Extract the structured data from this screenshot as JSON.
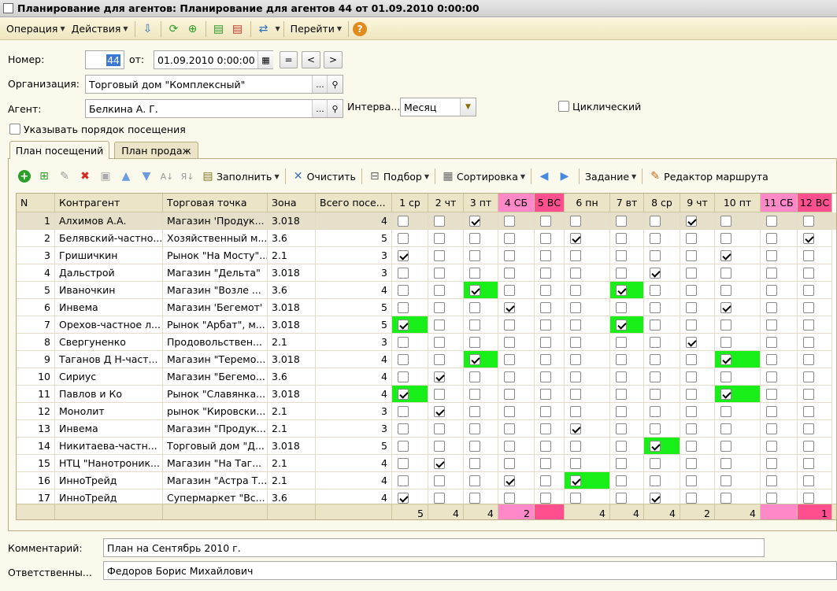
{
  "window": {
    "title": "Планирование для агентов: Планирование для агентов 44 от 01.09.2010 0:00:00"
  },
  "menubar": {
    "operation": "Операция",
    "actions": "Действия",
    "goto": "Перейти"
  },
  "form": {
    "number_label": "Номер:",
    "number": "44",
    "from_label": "от:",
    "date": "01.09.2010  0:00:00",
    "eq_btn": "=",
    "prev_btn": "<",
    "next_btn": ">",
    "org_label": "Организация:",
    "org": "Торговый дом \"Комплексный\"",
    "agent_label": "Агент:",
    "agent": "Белкина А. Г.",
    "interval_label": "Интерва...",
    "interval": "Месяц",
    "cyclic_label": "Циклический",
    "order_label": "Указывать порядок посещения",
    "ellipsis": "...",
    "comment_label": "Комментарий:",
    "comment": "План на Сентябрь 2010 г.",
    "resp_label": "Ответственны...",
    "resp": "Федоров Борис Михайлович"
  },
  "tabs": [
    "План посещений",
    "План продаж"
  ],
  "toolbar": {
    "fill": "Заполнить",
    "clear": "Очистить",
    "selection": "Подбор",
    "sort": "Сортировка",
    "task": "Задание",
    "route_editor": "Редактор маршрута"
  },
  "grid": {
    "headers": [
      "N",
      "Контрагент",
      "Торговая точка",
      "Зона",
      "Всего посе..."
    ],
    "days": [
      {
        "label": "1 ср",
        "kind": "work"
      },
      {
        "label": "2 чт",
        "kind": "work"
      },
      {
        "label": "3 пт",
        "kind": "work"
      },
      {
        "label": "4 СБ",
        "kind": "sat"
      },
      {
        "label": "5 ВС",
        "kind": "sun"
      },
      {
        "label": "6 пн",
        "kind": "work"
      },
      {
        "label": "7 вт",
        "kind": "work"
      },
      {
        "label": "8 ср",
        "kind": "work"
      },
      {
        "label": "9 чт",
        "kind": "work"
      },
      {
        "label": "10 пт",
        "kind": "work"
      },
      {
        "label": "11 СБ",
        "kind": "sat"
      },
      {
        "label": "12 ВС",
        "kind": "sun"
      }
    ],
    "rows": [
      {
        "n": "1",
        "contractor": "Алхимов А.А.",
        "point": "Магазин 'Продук...",
        "zone": "3.018",
        "total": "4",
        "checks": [
          0,
          0,
          1,
          0,
          0,
          0,
          0,
          0,
          1,
          0,
          0,
          0
        ],
        "green": []
      },
      {
        "n": "2",
        "contractor": "Белявский-частно...",
        "point": "Хозяйственный м...",
        "zone": "3.6",
        "total": "5",
        "checks": [
          0,
          0,
          0,
          0,
          0,
          1,
          0,
          0,
          0,
          0,
          0,
          1
        ],
        "green": []
      },
      {
        "n": "3",
        "contractor": "Гришичкин",
        "point": "Рынок \"На Мосту\"...",
        "zone": "2.1",
        "total": "3",
        "checks": [
          1,
          0,
          0,
          0,
          0,
          0,
          0,
          0,
          0,
          1,
          0,
          0
        ],
        "green": []
      },
      {
        "n": "4",
        "contractor": "Дальстрой",
        "point": "Магазин \"Дельта\"",
        "zone": "3.018",
        "total": "3",
        "checks": [
          0,
          0,
          0,
          0,
          0,
          0,
          0,
          1,
          0,
          0,
          0,
          0
        ],
        "green": []
      },
      {
        "n": "5",
        "contractor": "Иваночкин",
        "point": "Магазин \"Возле ...",
        "zone": "3.6",
        "total": "4",
        "checks": [
          0,
          0,
          1,
          0,
          0,
          0,
          1,
          0,
          0,
          0,
          0,
          0
        ],
        "green": [
          2,
          6
        ]
      },
      {
        "n": "6",
        "contractor": "Инвема",
        "point": "Магазин 'Бегемот'",
        "zone": "3.018",
        "total": "5",
        "checks": [
          0,
          0,
          0,
          1,
          0,
          0,
          0,
          0,
          0,
          1,
          0,
          0
        ],
        "green": []
      },
      {
        "n": "7",
        "contractor": "Орехов-частное л...",
        "point": "Рынок \"Арбат\", м...",
        "zone": "3.018",
        "total": "5",
        "checks": [
          1,
          0,
          0,
          0,
          0,
          0,
          1,
          0,
          0,
          0,
          0,
          0
        ],
        "green": [
          0,
          6
        ]
      },
      {
        "n": "8",
        "contractor": "Свергуненко",
        "point": "Продовольствен...",
        "zone": "2.1",
        "total": "3",
        "checks": [
          0,
          0,
          0,
          0,
          0,
          0,
          0,
          0,
          1,
          0,
          0,
          0
        ],
        "green": []
      },
      {
        "n": "9",
        "contractor": "Таганов Д Н-част...",
        "point": "Магазин \"Теремо...",
        "zone": "3.018",
        "total": "4",
        "checks": [
          0,
          0,
          1,
          0,
          0,
          0,
          0,
          0,
          0,
          1,
          0,
          0
        ],
        "green": [
          2,
          9
        ]
      },
      {
        "n": "10",
        "contractor": "Сириус",
        "point": "Магазин \"Бегемо...",
        "zone": "3.6",
        "total": "4",
        "checks": [
          0,
          1,
          0,
          0,
          0,
          0,
          0,
          0,
          0,
          0,
          0,
          0
        ],
        "green": []
      },
      {
        "n": "11",
        "contractor": "Павлов и Ко",
        "point": "Рынок \"Славянка...",
        "zone": "3.018",
        "total": "4",
        "checks": [
          1,
          0,
          0,
          0,
          0,
          0,
          0,
          0,
          0,
          1,
          0,
          0
        ],
        "green": [
          0,
          9
        ]
      },
      {
        "n": "12",
        "contractor": "Монолит",
        "point": "рынок \"Кировски...",
        "zone": "2.1",
        "total": "3",
        "checks": [
          0,
          1,
          0,
          0,
          0,
          0,
          0,
          0,
          0,
          0,
          0,
          0
        ],
        "green": []
      },
      {
        "n": "13",
        "contractor": "Инвема",
        "point": "Магазин \"Продук...",
        "zone": "2.1",
        "total": "3",
        "checks": [
          0,
          0,
          0,
          0,
          0,
          1,
          0,
          0,
          0,
          0,
          0,
          0
        ],
        "green": []
      },
      {
        "n": "14",
        "contractor": "Никитаева-частн...",
        "point": "Торговый дом \"Д...",
        "zone": "3.018",
        "total": "5",
        "checks": [
          0,
          0,
          0,
          0,
          0,
          0,
          0,
          1,
          0,
          0,
          0,
          0
        ],
        "green": [
          7
        ]
      },
      {
        "n": "15",
        "contractor": "НТЦ \"Нанотроник...",
        "point": "Магазин \"На Таг...",
        "zone": "2.1",
        "total": "4",
        "checks": [
          0,
          1,
          0,
          0,
          0,
          0,
          0,
          0,
          0,
          0,
          0,
          0
        ],
        "green": []
      },
      {
        "n": "16",
        "contractor": "ИнноТрейд",
        "point": "Магазин \"Астра Т...",
        "zone": "2.1",
        "total": "4",
        "checks": [
          0,
          0,
          0,
          1,
          0,
          1,
          0,
          0,
          0,
          0,
          0,
          0
        ],
        "green": [
          5
        ]
      },
      {
        "n": "17",
        "contractor": "ИнноТрейд",
        "point": "Супермаркет \"Вс...",
        "zone": "3.6",
        "total": "4",
        "checks": [
          1,
          0,
          0,
          0,
          0,
          0,
          0,
          1,
          0,
          0,
          0,
          0
        ],
        "green": []
      }
    ],
    "totals": [
      "5",
      "4",
      "4",
      "2",
      "",
      "4",
      "4",
      "4",
      "2",
      "4",
      "",
      "1"
    ]
  }
}
